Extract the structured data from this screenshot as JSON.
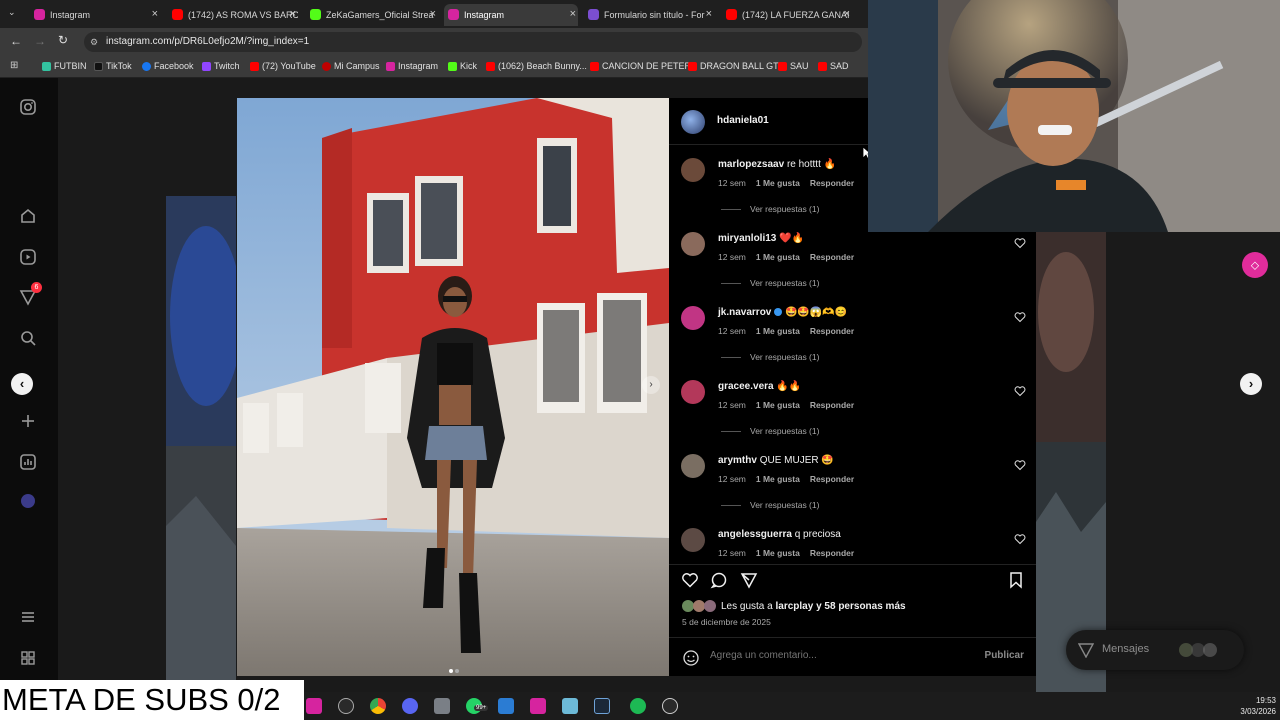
{
  "browser": {
    "tabs": [
      {
        "label": "Instagram",
        "color": "#d6249f"
      },
      {
        "label": "(1742) AS ROMA VS BARC",
        "color": "#ff0000"
      },
      {
        "label": "ZeKaGamers_Oficial Strea",
        "color": "#53fc18"
      },
      {
        "label": "Instagram",
        "color": "#d6249f"
      },
      {
        "label": "Formulario sin título - For",
        "color": "#7b4ed1"
      },
      {
        "label": "(1742) LA FUERZA GANAI",
        "color": "#ff0000"
      }
    ],
    "url": "instagram.com/p/DR6L0efjo2M/?img_index=1",
    "bookmarks": [
      {
        "label": "FUTBIN",
        "color": "#33c3a0"
      },
      {
        "label": "TikTok",
        "color": "#111111"
      },
      {
        "label": "Facebook",
        "color": "#1877f2"
      },
      {
        "label": "Twitch",
        "color": "#9146ff"
      },
      {
        "label": "(72) YouTube",
        "color": "#ff0000"
      },
      {
        "label": "Mi Campus",
        "color": "#c00000"
      },
      {
        "label": "Instagram",
        "color": "#d6249f"
      },
      {
        "label": "Kick",
        "color": "#53fc18"
      },
      {
        "label": "(1062) Beach Bunny...",
        "color": "#ff0000"
      },
      {
        "label": "CANCION DE PETER",
        "color": "#ff0000"
      },
      {
        "label": "DRAGON BALL GT",
        "color": "#ff0000"
      },
      {
        "label": "SAU",
        "color": "#ff0000"
      },
      {
        "label": "SAD",
        "color": "#ff0000"
      }
    ]
  },
  "nav": {
    "badge": "6"
  },
  "post": {
    "author": "hdaniela01",
    "comments": [
      {
        "user": "marlopezsaav",
        "text": "re hotttt 🔥",
        "time": "12 sem",
        "likes": "1 Me gusta",
        "reply": "Responder",
        "replies": "Ver respuestas (1)",
        "avatar_color": "#6b4a3a"
      },
      {
        "user": "miryanloli13",
        "text": "❤️🔥",
        "time": "12 sem",
        "likes": "1 Me gusta",
        "reply": "Responder",
        "replies": "Ver respuestas (1)",
        "avatar_color": "#8a6a5c"
      },
      {
        "user": "jk.navarrov",
        "text": "🤩🤩😱🫶😊",
        "time": "12 sem",
        "likes": "1 Me gusta",
        "reply": "Responder",
        "replies": "Ver respuestas (1)",
        "avatar_color": "#c13584"
      },
      {
        "user": "gracee.vera",
        "text": "🔥🔥",
        "time": "12 sem",
        "likes": "1 Me gusta",
        "reply": "Responder",
        "replies": "Ver respuestas (1)",
        "avatar_color": "#b3385a"
      },
      {
        "user": "arymthv",
        "text": "QUE MUJER 🤩",
        "time": "12 sem",
        "likes": "1 Me gusta",
        "reply": "Responder",
        "replies": "Ver respuestas (1)",
        "avatar_color": "#7a6e62"
      },
      {
        "user": "angelessguerra",
        "text": "q preciosa",
        "time": "12 sem",
        "likes": "1 Me gusta",
        "reply": "Responder",
        "replies": "",
        "avatar_color": "#5c4a44"
      }
    ],
    "likes_prefix": "Les gusta a ",
    "likes_user": "larcplay",
    "likes_rest": "y 58 personas más",
    "date": "5 de diciembre de 2025",
    "comment_placeholder": "Agrega un comentario...",
    "publish": "Publicar"
  },
  "messages": {
    "label": "Mensajes"
  },
  "overlay": {
    "meta_subs": "META DE SUBS 0/2"
  },
  "clock": {
    "time": "19:53",
    "date": "3/03/2026"
  },
  "taskbar": {
    "badge": "99+"
  }
}
